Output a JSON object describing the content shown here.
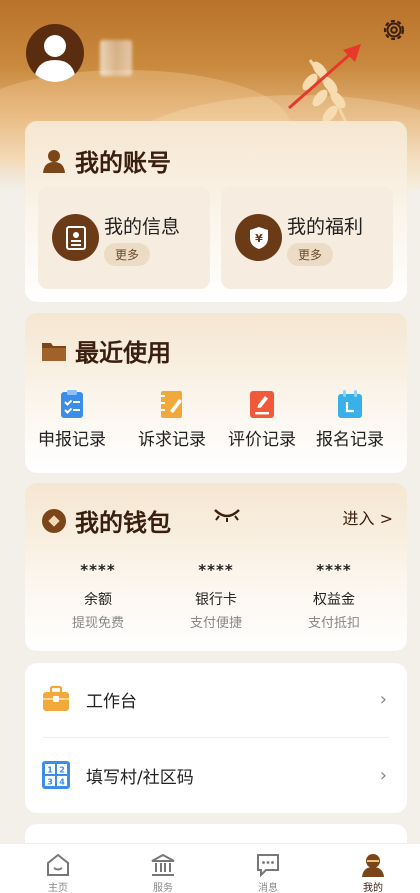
{
  "account": {
    "title": "我的账号",
    "tiles": [
      {
        "label": "我的信息",
        "more": "更多"
      },
      {
        "label": "我的福利",
        "more": "更多"
      }
    ]
  },
  "recent": {
    "title": "最近使用",
    "items": [
      {
        "label": "申报记录",
        "icon": "clipboard-check-icon",
        "color": "#3a8de8"
      },
      {
        "label": "诉求记录",
        "icon": "notebook-pen-icon",
        "color": "#f2a93b"
      },
      {
        "label": "评价记录",
        "icon": "edit-doc-icon",
        "color": "#f05a3a"
      },
      {
        "label": "报名记录",
        "icon": "calendar-icon",
        "color": "#3ab0e8"
      }
    ]
  },
  "wallet": {
    "title": "我的钱包",
    "enter": "进入 >",
    "cols": [
      {
        "value": "****",
        "label": "余额",
        "sub": "提现免费"
      },
      {
        "value": "****",
        "label": "银行卡",
        "sub": "支付便捷"
      },
      {
        "value": "****",
        "label": "权益金",
        "sub": "支付抵扣"
      }
    ]
  },
  "list": {
    "rows": [
      {
        "label": "工作台",
        "icon": "briefcase-icon",
        "chev": "›"
      },
      {
        "label": "填写村/社区码",
        "icon": "number-grid-icon",
        "chev": "›"
      }
    ]
  },
  "tabs": [
    {
      "label": "主页",
      "icon": "home-icon",
      "active": false
    },
    {
      "label": "服务",
      "icon": "bank-icon",
      "active": false
    },
    {
      "label": "消息",
      "icon": "message-icon",
      "active": false
    },
    {
      "label": "我的",
      "icon": "person-icon",
      "active": true
    }
  ],
  "colors": {
    "brand_brown": "#6b3a17",
    "title_brown": "#3a1f0e",
    "arrow_red": "#e8382a"
  }
}
